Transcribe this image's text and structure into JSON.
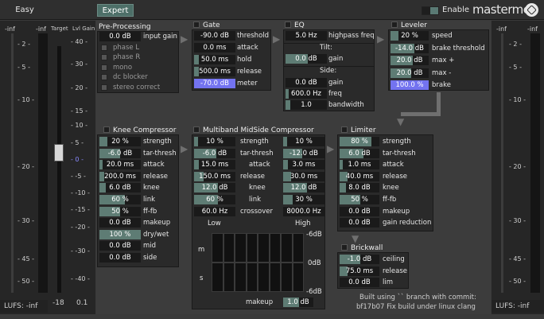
{
  "tabs": {
    "easy": "Easy",
    "expert": "Expert"
  },
  "header": {
    "enable": "Enable",
    "brand": "masterme"
  },
  "left_meter": {
    "col_in_l": "-inf",
    "col_in_r": "-inf",
    "col_target": "Target",
    "col_lvl": "Lvl Gain",
    "ticks_left": [
      "- 2 -",
      "- 5 -",
      "- 10 -",
      "- 20 -",
      "- 30 -",
      "- 45 -",
      "- 50 -"
    ],
    "ticks_right": [
      "- 40 -",
      "- 30 -",
      "- 20 -",
      "- 15 -",
      "- 10 -",
      "- 5 -",
      "- 0 -",
      "- -5 -",
      "- -10 -",
      "- -15 -",
      "- -20 -",
      "- -30 -",
      "- -40 -"
    ],
    "target_value": "-18",
    "lvl_value": "0.1",
    "lufs": "LUFS: -inf"
  },
  "right_meter": {
    "col_l": "-inf",
    "col_r": "-inf",
    "ticks": [
      "- 2 -",
      "- 5 -",
      "- 10 -",
      "- 20 -",
      "- 30 -",
      "- 45 -",
      "- 50 -"
    ],
    "lufs": "LUFS: -inf"
  },
  "preproc": {
    "title": "Pre-Processing",
    "input_gain_value": "0.0 dB",
    "input_gain_label": "input gain",
    "opts": [
      "phase L",
      "phase R",
      "mono",
      "dc blocker",
      "stereo correct"
    ]
  },
  "gate": {
    "title": "Gate",
    "rows": [
      {
        "v": "-90.0 dB",
        "l": "threshold"
      },
      {
        "v": "0.0 ms",
        "l": "attack"
      },
      {
        "v": "50.0 ms",
        "l": "hold"
      },
      {
        "v": "500.0 ms",
        "l": "release"
      },
      {
        "v": "-70.0 dB",
        "l": "meter"
      }
    ]
  },
  "eq": {
    "title": "EQ",
    "hp_value": "5.0 Hz",
    "hp_label": "highpass freq",
    "tilt": "Tilt:",
    "tilt_gain_v": "0.0 dB",
    "tilt_gain_l": "gain",
    "side": "Side:",
    "side_gain_v": "0.0 dB",
    "side_gain_l": "gain",
    "freq_v": "600.0 Hz",
    "freq_l": "freq",
    "bw_v": "1.0",
    "bw_l": "bandwidth"
  },
  "leveler": {
    "title": "Leveler",
    "rows": [
      {
        "v": "20 %",
        "l": "speed"
      },
      {
        "v": "-14.0 dB",
        "l": "brake threshold"
      },
      {
        "v": "20.0 dB",
        "l": "max +"
      },
      {
        "v": "20.0 dB",
        "l": "max -"
      },
      {
        "v": "100.0 %",
        "l": "brake"
      }
    ]
  },
  "knee": {
    "title": "Knee Compressor",
    "rows": [
      {
        "v": "20 %",
        "l": "strength"
      },
      {
        "v": "-6.0 dB",
        "l": "tar-thresh"
      },
      {
        "v": "20.0 ms",
        "l": "attack"
      },
      {
        "v": "200.0 ms",
        "l": "release"
      },
      {
        "v": "6.0 dB",
        "l": "knee"
      },
      {
        "v": "60 %",
        "l": "link"
      },
      {
        "v": "50 %",
        "l": "ff-fb"
      },
      {
        "v": "0.0 dB",
        "l": "makeup"
      },
      {
        "v": "100 %",
        "l": "dry/wet"
      },
      {
        "v": "0.0 dB",
        "l": "mid"
      },
      {
        "v": "0.0 dB",
        "l": "side"
      }
    ]
  },
  "multiband": {
    "title": "Multiband MidSide Compressor",
    "rows": [
      {
        "a": "10 %",
        "l": "strength",
        "b": "10 %"
      },
      {
        "a": "-6.0 dB",
        "l": "tar-thresh",
        "b": "-12.0 dB"
      },
      {
        "a": "15.0 ms",
        "l": "attack",
        "b": "3.0 ms"
      },
      {
        "a": "150.0 ms",
        "l": "release",
        "b": "30.0 ms"
      },
      {
        "a": "12.0 dB",
        "l": "knee",
        "b": "12.0 dB"
      },
      {
        "a": "60 %",
        "l": "link",
        "b": "30 %"
      },
      {
        "a": "60.0 Hz",
        "l": "crossover",
        "b": "8000.0 Hz"
      }
    ],
    "low": "Low",
    "high": "High",
    "m": "m",
    "s": "s",
    "db_top": "-6dB",
    "db_mid": "0dB",
    "db_bot": "-6dB",
    "makeup_l": "makeup",
    "makeup_v": "1.0 dB"
  },
  "limiter": {
    "title": "Limiter",
    "rows": [
      {
        "v": "80 %",
        "l": "strength"
      },
      {
        "v": "6.0 dB",
        "l": "tar-thresh"
      },
      {
        "v": "1.0 ms",
        "l": "attack"
      },
      {
        "v": "40.0 ms",
        "l": "release"
      },
      {
        "v": "8.0 dB",
        "l": "knee"
      },
      {
        "v": "50 %",
        "l": "ff-fb"
      },
      {
        "v": "0.0 dB",
        "l": "makeup"
      },
      {
        "v": "0.0 dB",
        "l": "gain reduction"
      }
    ]
  },
  "brickwall": {
    "title": "Brickwall",
    "rows": [
      {
        "v": "-1.0 dB",
        "l": "ceiling"
      },
      {
        "v": "75.0 ms",
        "l": "release"
      },
      {
        "v": "0.0 dB",
        "l": "lim"
      }
    ]
  },
  "footer": {
    "line1": "Built using `` branch with commit:",
    "line2": "bf17b07 Fix build under linux clang"
  }
}
